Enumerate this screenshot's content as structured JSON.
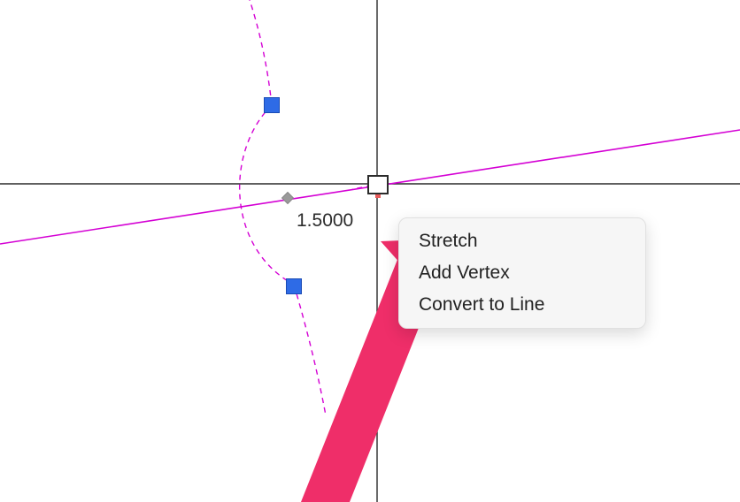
{
  "dimension": {
    "value": "1.5000"
  },
  "context_menu": {
    "items": [
      {
        "label": "Stretch"
      },
      {
        "label": "Add Vertex"
      },
      {
        "label": "Convert to Line"
      }
    ]
  },
  "colors": {
    "axis": "#2b2b2b",
    "magenta": "#d400d4",
    "grip": "#2e6be6",
    "arrow": "#ef2e69"
  }
}
